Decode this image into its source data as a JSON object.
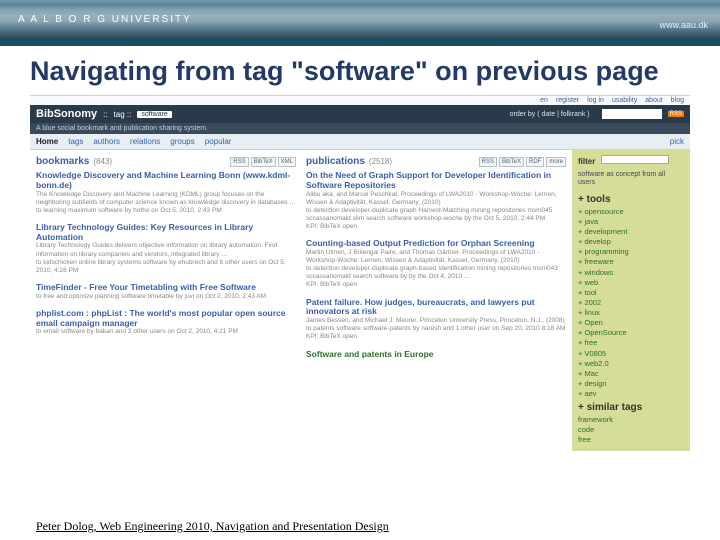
{
  "banner": {
    "logo_text": "A A L B O R G   UNIVERSITY",
    "url": "www.aau.dk"
  },
  "slide": {
    "title": "Navigating from tag \"software\" on previous page"
  },
  "app": {
    "top_links": [
      "en",
      "register",
      "log in",
      "usability",
      "about",
      "blog"
    ],
    "header": {
      "site": "BibSonomy",
      "breadcrumb_sep": "::",
      "section": "tag ::",
      "tag": "software",
      "order_label": "order by ( date | folkrank )",
      "search_placeholder": "",
      "rss": "RSS"
    },
    "subheader": "A blue social bookmark and publication sharing system.",
    "nav": [
      "Home",
      "tags",
      "authors",
      "relations",
      "groups",
      "popular",
      "pick"
    ],
    "columns": {
      "bookmarks": {
        "title": "bookmarks",
        "count": "(843)",
        "chips": [
          "RSS",
          "BibTeX",
          "XML"
        ],
        "items": [
          {
            "title": "Knowledge Discovery and Machine Learning Bonn (www.kdml-bonn.de)",
            "sub": "The Knowledge Discovery and Machine Learning (KDML) group focuses on the neighboring subfields of computer science known as knowledge discovery in databases …",
            "meta": "to learning maximum software by hotho on Oct 5, 2010, 2:43 PM"
          },
          {
            "title": "Library Technology Guides: Key Resources in Library Automation",
            "sub": "Library Technology Guides delivers objective information on library automation. Find information on library companies and vendors, integrated library …",
            "meta": "to kidschicken online library systems software by ehubrech and 6 other users on Oct 5, 2010, 4:28 PM"
          },
          {
            "title": "TimeFinder - Free Your Timetabling with Free Software",
            "sub": "to free and optimize planning software timetable by juvi on Oct 2, 2010, 2:43 AM",
            "meta": ""
          },
          {
            "title": "phplist.com : phpList : The world's most popular open source email campaign manager",
            "sub": "to email software by bakan and 3 other users on Oct 2, 2010, 4:21 PM",
            "meta": ""
          }
        ]
      },
      "publications": {
        "title": "publications",
        "count": "(2518)",
        "chips": [
          "RSS",
          "BibTeX",
          "RDF",
          "more"
        ],
        "items": [
          {
            "title": "On the Need of Graph Support for Developer Identification in Software Repositories",
            "sub": "Alibu aka, and Marcel Peschkat. Proceedings of LWA2010 - Workshop-Woche: Lernen, Wissen & Adaptivität, Kassel, Germany, (2010)",
            "meta": "to detection developer-duplicate graph Harvest-Matching mining repositories msm045 sccassanomald slim search software workshop-woche by the Oct 5, 2010, 2:44 PM",
            "meta2": "KPI: BibTeX open"
          },
          {
            "title": "Counting-based Output Prediction for Orphan Screening",
            "sub": "Martin Ulmen, J Brilengal Paire, and Thomas Gärtner. Proceedings of LWA2010 - Workshop-Woche: Lernen, Wissen & Adaptivität, Kassel, Germany, (2010)",
            "meta": "to detection developer-duplicate graph-based Identification mining repositories msm043 sccassanomald search software by by the Oct 4, 2010 …",
            "meta2": "KPI: BibTeX open"
          },
          {
            "title": "Patent failure. How judges, bureaucrats, and lawyers put innovators at risk",
            "sub": "James Bessen, and Michael J. Meurer. Princeton University Press, Princeton, N.J., (2008)",
            "meta": "to patents software software-patents by naresh and 1 other user on Sep 20, 2010 8:18 AM",
            "meta2": "KPI: BibTeX open"
          },
          {
            "title": "Software and patents in Europe",
            "sub": "",
            "meta": ""
          }
        ]
      }
    },
    "sidebar": {
      "filter_label": "filter",
      "concept_text": "software as concept from all users",
      "tools_label": "+ tools",
      "tools": [
        "+ opensource",
        "+ java",
        "+ development",
        "+ develop",
        "+ programming",
        "+ freeware",
        "+ windows",
        "+ web",
        "+ tool",
        "+ 2002",
        "+ linux",
        "+ Open",
        "+ OpenSource",
        "+ free",
        "+ V0805",
        "+ web2.0",
        "+ Mac",
        "+ design",
        "+ aev"
      ],
      "similar_label": "+ similar tags",
      "similar": [
        "framework",
        "code",
        "free"
      ]
    }
  },
  "footer": "Peter Dolog, Web Engineering 2010, Navigation and Presentation Design"
}
